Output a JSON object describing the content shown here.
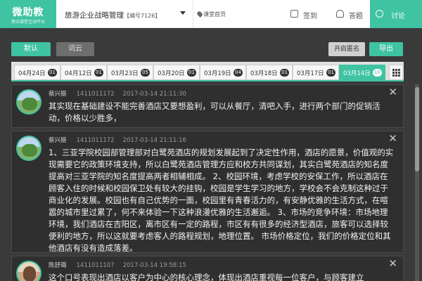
{
  "header": {
    "logo_main": "微助教",
    "logo_sub": "移动课堂互动平台",
    "course_name": "旅游企业战略管理",
    "course_code": "【编号7126】",
    "home_link": "课堂首页",
    "nav": [
      {
        "label": "签到",
        "icon": "checkin-icon"
      },
      {
        "label": "答题",
        "icon": "quiz-icon"
      },
      {
        "label": "讨论",
        "icon": "discussion-icon",
        "active": true
      }
    ]
  },
  "toolbar": {
    "default_label": "默认",
    "cloud_label": "词云",
    "anonymous_label": "开启匿名",
    "export_label": "导出"
  },
  "tabs": [
    {
      "date": "04月24日",
      "count": "01"
    },
    {
      "date": "04月12日",
      "count": "01"
    },
    {
      "date": "03月23日",
      "count": "05"
    },
    {
      "date": "03月20日",
      "count": "01"
    },
    {
      "date": "03月19日",
      "count": "04"
    },
    {
      "date": "03月18日",
      "count": "01"
    },
    {
      "date": "03月17日",
      "count": "01"
    },
    {
      "date": "03月14日",
      "count": "10",
      "active": true
    }
  ],
  "posts": [
    {
      "name": "蔡兴振",
      "student_id": "1411011172",
      "time": "2017-03-14 21:11:30",
      "content": "其实现在基础建设不能完善酒店又要想盈利，可以从餐厅，清吧入手，进行两个部门的促销活动，价格以少胜多，"
    },
    {
      "name": "蔡兴振",
      "student_id": "1411011172",
      "time": "2017-03-14 21:11:16",
      "content": "1、三亚学院校园部管理部对白鹭苑酒店的规划发展起到了决定性作用，酒店的愿景，价值观的实现需要它的政策环境支持，所以白鹭苑酒店管理方应和校方共同谋划，其实白鹭苑酒店的知名度提高对三亚学院的知名度提高两者相辅相成。 2、校园环境，考虑学校的安保工作，所以酒店在顾客入住的时候和校园保卫处有较大的挂钩，校园是学生学习的地方，学校会不会克制这种过于商业化的发展。校园也有自己优势的一面，校园里有青春活力的，有安静优雅的生活方式，在喧嚣的城市里过累了，何不来体验一下这种浪漫优雅的生活邂逅。 3、市场的竞争环境：市场地理环境，我们酒店在吉阳区，离市区有一定的路程，市区有有很多的经济型酒店，旅客可以选择较便利的地方，所以这就要考虑客人的路程规划，地理位置。 市场价格定位，我们的价格定位和其他酒店有没有造成落差。"
    },
    {
      "name": "陈舒璐",
      "student_id": "1411011107",
      "time": "2017-03-14 19:58:15",
      "content": "这个口号表现出酒店以客户为中心的核心理念，体现出酒店重视每一位客户，与顾客建立"
    }
  ]
}
